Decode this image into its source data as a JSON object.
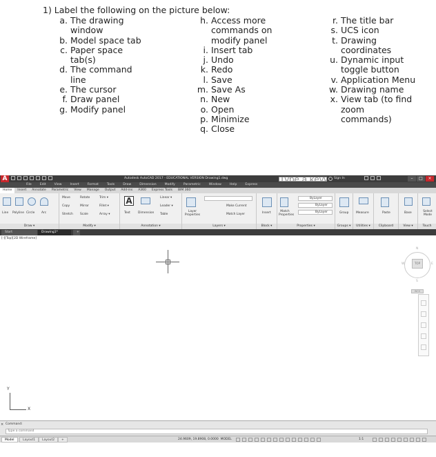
{
  "worksheet": {
    "title": "1) Label the following on the picture below:",
    "col1": [
      {
        "letter": "a.",
        "text": "The drawing"
      },
      {
        "letter": "",
        "text": "window"
      },
      {
        "letter": "b.",
        "text": "Model space tab"
      },
      {
        "letter": "c.",
        "text": "Paper space"
      },
      {
        "letter": "",
        "text": "tab(s)"
      },
      {
        "letter": "d.",
        "text": "The command"
      },
      {
        "letter": "",
        "text": "line"
      },
      {
        "letter": "e.",
        "text": "The cursor"
      },
      {
        "letter": "f.",
        "text": "Draw panel"
      },
      {
        "letter": "g.",
        "text": "Modify panel"
      }
    ],
    "col2": [
      {
        "letter": "h.",
        "text": "Access more"
      },
      {
        "letter": "",
        "text": "commands on"
      },
      {
        "letter": "",
        "text": "modify panel"
      },
      {
        "letter": "i.",
        "text": "Insert tab"
      },
      {
        "letter": "j.",
        "text": "Undo"
      },
      {
        "letter": "k.",
        "text": "Redo"
      },
      {
        "letter": "l.",
        "text": "Save"
      },
      {
        "letter": "m.",
        "text": "Save As"
      },
      {
        "letter": "n.",
        "text": "New"
      },
      {
        "letter": "o.",
        "text": "Open"
      },
      {
        "letter": "p.",
        "text": "Minimize"
      },
      {
        "letter": "q.",
        "text": "Close"
      }
    ],
    "col3": [
      {
        "letter": "r.",
        "text": "The title bar"
      },
      {
        "letter": "s.",
        "text": "UCS icon"
      },
      {
        "letter": "t.",
        "text": "Drawing"
      },
      {
        "letter": "",
        "text": "coordinates"
      },
      {
        "letter": "u.",
        "text": "Dynamic input"
      },
      {
        "letter": "",
        "text": "toggle button"
      },
      {
        "letter": "v.",
        "text": "Application Menu"
      },
      {
        "letter": "w.",
        "text": "Drawing name"
      },
      {
        "letter": "x.",
        "text": "View tab (to find"
      },
      {
        "letter": "",
        "text": "zoom"
      },
      {
        "letter": "",
        "text": "commands)"
      }
    ]
  },
  "acad": {
    "app_letter": "A",
    "title": "Autodesk AutoCAD 2017 - EDUCATIONAL VERSION   Drawing1.dwg",
    "search_placeholder": "Type a keyword or phrase",
    "signin": "Sign In",
    "menu": [
      "File",
      "Edit",
      "View",
      "Insert",
      "Format",
      "Tools",
      "Draw",
      "Dimension",
      "Modify",
      "Parametric",
      "Window",
      "Help",
      "Express"
    ],
    "ribbon_tabs": [
      "Home",
      "Insert",
      "Annotate",
      "Parametric",
      "View",
      "Manage",
      "Output",
      "Add-ins",
      "A360",
      "Express Tools",
      "BIM 360"
    ],
    "panels": {
      "draw": {
        "label": "Draw ▾",
        "tools": [
          "Line",
          "Polyline",
          "Circle",
          "Arc"
        ]
      },
      "modify": {
        "label": "Modify ▾",
        "tools": [
          "Move",
          "Rotate",
          "Trim ▾",
          "Copy",
          "Mirror",
          "Fillet ▾",
          "Stretch",
          "Scale",
          "Array ▾"
        ]
      },
      "annotation": {
        "label": "Annotation ▾",
        "tools": [
          "Text",
          "Dimension",
          "Linear ▾",
          "Leader ▾",
          "Table"
        ]
      },
      "layers": {
        "label": "Layers ▾",
        "tools": [
          "Layer Properties",
          "Make Current",
          "Match Layer"
        ]
      },
      "block": {
        "label": "Block ▾",
        "tools": [
          "Insert"
        ]
      },
      "properties": {
        "label": "Properties ▾",
        "tools": [
          "Match Properties",
          "ByLayer",
          "ByLayer",
          "ByLayer"
        ]
      },
      "groups": {
        "label": "Groups ▾",
        "tools": [
          "Group"
        ]
      },
      "utilities": {
        "label": "Utilities ▾",
        "tools": [
          "Measure"
        ]
      },
      "clipboard": {
        "label": "Clipboard",
        "tools": [
          "Paste"
        ]
      },
      "view": {
        "label": "View ▾",
        "tools": []
      },
      "touch": {
        "label": "Touch",
        "tools": [
          "Select Mode"
        ]
      },
      "base": {
        "tools": [
          "Base"
        ]
      }
    },
    "file_tabs": {
      "start": "Start",
      "drawing": "Drawing1*",
      "close": "×",
      "plus": "+"
    },
    "viewport_label": "[-][Top][2D Wireframe]",
    "viewcube": {
      "top": "TOP",
      "n": "N",
      "w": "W",
      "e": "E",
      "s": "S",
      "wcs": "WCS"
    },
    "ucs": {
      "x": "X",
      "y": "Y"
    },
    "command": {
      "history": "Command:",
      "placeholder": "Type a command",
      "close": "×"
    },
    "status": {
      "tabs": [
        "Model",
        "Layout1",
        "Layout2",
        "+"
      ],
      "coords": "24.9609, 19.8908, 0.0000",
      "mode": "MODEL",
      "scale": "1:1"
    }
  }
}
